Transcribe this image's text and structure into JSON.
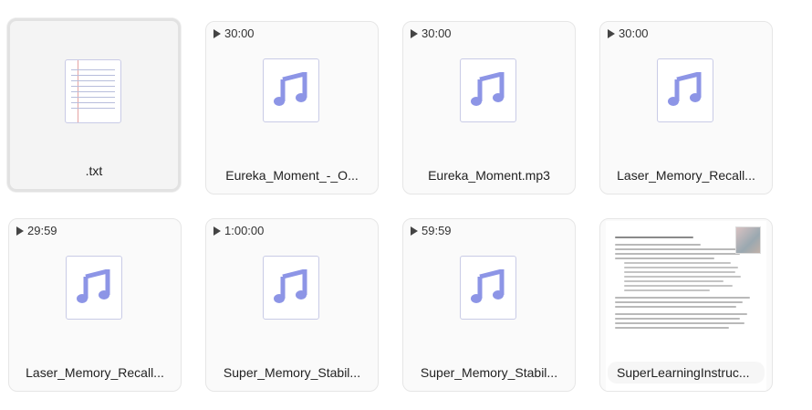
{
  "files": [
    {
      "name": ".txt",
      "type": "text",
      "duration": "",
      "selected": true
    },
    {
      "name": "Eureka_Moment_-_O...",
      "type": "audio",
      "duration": "30:00"
    },
    {
      "name": "Eureka_Moment.mp3",
      "type": "audio",
      "duration": "30:00"
    },
    {
      "name": "Laser_Memory_Recall...",
      "type": "audio",
      "duration": "30:00"
    },
    {
      "name": "Laser_Memory_Recall...",
      "type": "audio",
      "duration": "29:59"
    },
    {
      "name": "Super_Memory_Stabil...",
      "type": "audio",
      "duration": "1:00:00"
    },
    {
      "name": "Super_Memory_Stabil...",
      "type": "audio",
      "duration": "59:59"
    },
    {
      "name": "SuperLearningInstruc...",
      "type": "document",
      "duration": ""
    }
  ],
  "icons": {
    "audio": "music-note-icon",
    "text": "text-file-icon",
    "document": "document-preview",
    "play": "play-icon"
  },
  "colors": {
    "music_note": "#8d95e6",
    "thumb_border": "#c9cbe6"
  }
}
